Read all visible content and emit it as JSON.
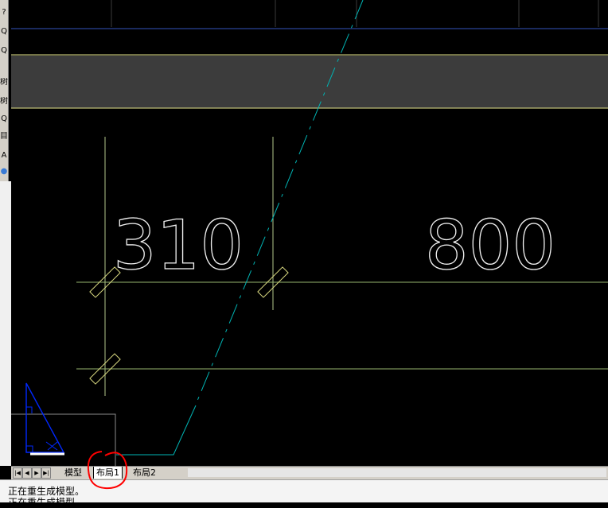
{
  "left_toolbar": {
    "glyphs": [
      "?",
      "Q",
      "Q",
      "树",
      "树",
      "Q",
      "目",
      "A",
      "●"
    ]
  },
  "drawing": {
    "dimension_texts": [
      "310",
      "800"
    ]
  },
  "tabs": {
    "items": [
      {
        "label": "模型",
        "active": false
      },
      {
        "label": "布局1",
        "active": true
      },
      {
        "label": "布局2",
        "active": false
      }
    ]
  },
  "command_history": [
    "正在重生成模型。",
    "正在重生成模型。"
  ],
  "colors": {
    "background": "#000000",
    "cyan_line": "#00b4b4",
    "yellow_line": "#e6e68c",
    "band": "#3c3c3c",
    "blue_ucs": "#0028ff",
    "annotation": "#ff0000"
  }
}
